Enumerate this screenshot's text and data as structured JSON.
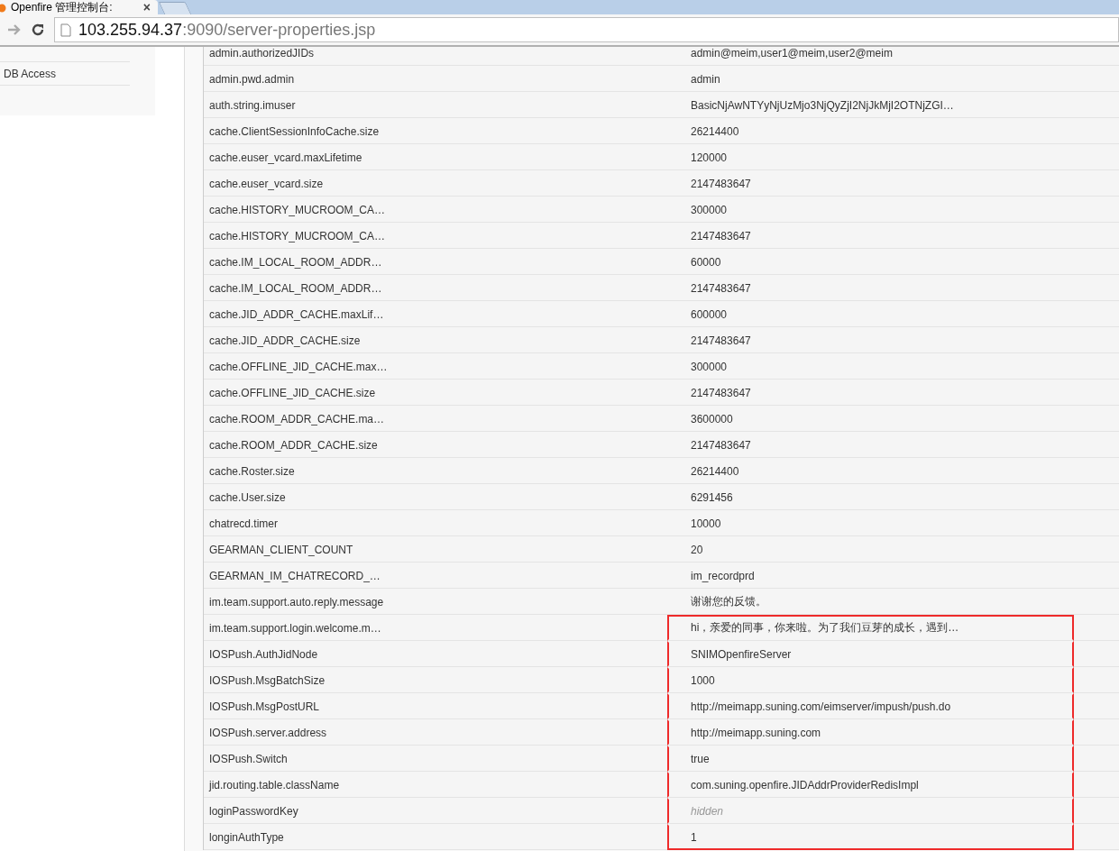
{
  "browser": {
    "tab_title": "Openfire 管理控制台:",
    "tab_close": "×",
    "url_host": "103.255.94.37",
    "url_rest": ":9090/server-properties.jsp"
  },
  "sidebar": {
    "items": [
      {
        "label": "DB Access",
        "selected": false
      }
    ]
  },
  "properties": [
    {
      "name": "admin.authorizedJIDs",
      "value": "admin@meim,user1@meim,user2@meim",
      "masked": false,
      "highlighted": false
    },
    {
      "name": "admin.pwd.admin",
      "value": "admin",
      "masked": false,
      "highlighted": false
    },
    {
      "name": "auth.string.imuser",
      "value": "BasicNjAwNTYyNjUzMjo3NjQyZjI2NjJkMjI2OTNjZGI…",
      "masked": false,
      "highlighted": false
    },
    {
      "name": "cache.ClientSessionInfoCache.size",
      "value": "26214400",
      "masked": false,
      "highlighted": false
    },
    {
      "name": "cache.euser_vcard.maxLifetime",
      "value": "120000",
      "masked": false,
      "highlighted": false
    },
    {
      "name": "cache.euser_vcard.size",
      "value": "2147483647",
      "masked": false,
      "highlighted": false
    },
    {
      "name": "cache.HISTORY_MUCROOM_CA…",
      "value": "300000",
      "masked": false,
      "highlighted": false
    },
    {
      "name": "cache.HISTORY_MUCROOM_CA…",
      "value": "2147483647",
      "masked": false,
      "highlighted": false
    },
    {
      "name": "cache.IM_LOCAL_ROOM_ADDR…",
      "value": "60000",
      "masked": false,
      "highlighted": false
    },
    {
      "name": "cache.IM_LOCAL_ROOM_ADDR…",
      "value": "2147483647",
      "masked": false,
      "highlighted": false
    },
    {
      "name": "cache.JID_ADDR_CACHE.maxLif…",
      "value": "600000",
      "masked": false,
      "highlighted": false
    },
    {
      "name": "cache.JID_ADDR_CACHE.size",
      "value": "2147483647",
      "masked": false,
      "highlighted": false
    },
    {
      "name": "cache.OFFLINE_JID_CACHE.max…",
      "value": "300000",
      "masked": false,
      "highlighted": false
    },
    {
      "name": "cache.OFFLINE_JID_CACHE.size",
      "value": "2147483647",
      "masked": false,
      "highlighted": false
    },
    {
      "name": "cache.ROOM_ADDR_CACHE.ma…",
      "value": "3600000",
      "masked": false,
      "highlighted": false
    },
    {
      "name": "cache.ROOM_ADDR_CACHE.size",
      "value": "2147483647",
      "masked": false,
      "highlighted": false
    },
    {
      "name": "cache.Roster.size",
      "value": "26214400",
      "masked": false,
      "highlighted": false
    },
    {
      "name": "cache.User.size",
      "value": "6291456",
      "masked": false,
      "highlighted": false
    },
    {
      "name": "chatrecd.timer",
      "value": "10000",
      "masked": false,
      "highlighted": false
    },
    {
      "name": "GEARMAN_CLIENT_COUNT",
      "value": "20",
      "masked": false,
      "highlighted": false
    },
    {
      "name": "GEARMAN_IM_CHATRECORD_…",
      "value": "im_recordprd",
      "masked": false,
      "highlighted": false
    },
    {
      "name": "im.team.support.auto.reply.message",
      "value": "谢谢您的反馈。",
      "masked": false,
      "highlighted": false
    },
    {
      "name": "im.team.support.login.welcome.m…",
      "value": "hi，亲爱的同事，你来啦。为了我们豆芽的成长，遇到…",
      "masked": false,
      "highlighted": true
    },
    {
      "name": "IOSPush.AuthJidNode",
      "value": "SNIMOpenfireServer",
      "masked": false,
      "highlighted": true
    },
    {
      "name": "IOSPush.MsgBatchSize",
      "value": "1000",
      "masked": false,
      "highlighted": true
    },
    {
      "name": "IOSPush.MsgPostURL",
      "value": "http://meimapp.suning.com/eimserver/impush/push.do",
      "masked": false,
      "highlighted": true
    },
    {
      "name": "IOSPush.server.address",
      "value": "http://meimapp.suning.com",
      "masked": false,
      "highlighted": true
    },
    {
      "name": "IOSPush.Switch",
      "value": "true",
      "masked": false,
      "highlighted": true
    },
    {
      "name": "jid.routing.table.className",
      "value": "com.suning.openfire.JIDAddrProviderRedisImpl",
      "masked": false,
      "highlighted": true
    },
    {
      "name": "loginPasswordKey",
      "value": "hidden",
      "masked": true,
      "highlighted": true
    },
    {
      "name": "longinAuthType",
      "value": "1",
      "masked": false,
      "highlighted": true
    }
  ]
}
